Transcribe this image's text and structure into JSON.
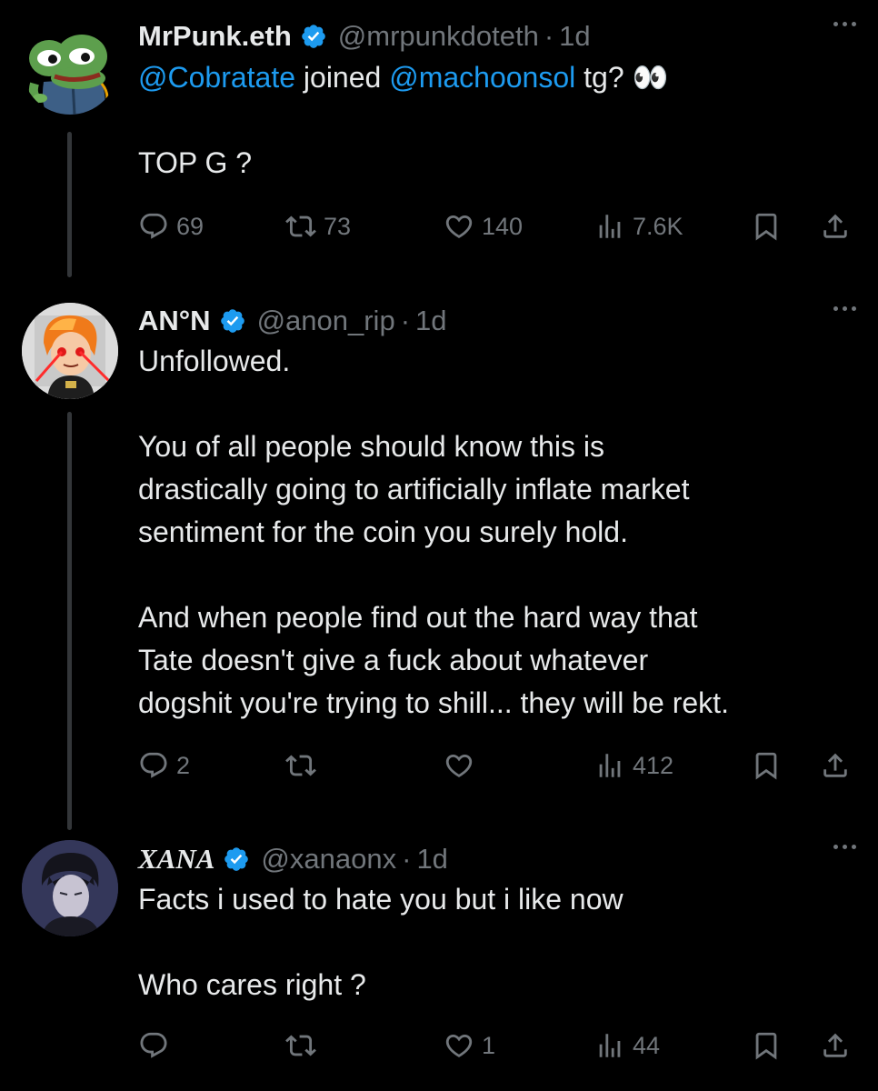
{
  "tweets": [
    {
      "name": "MrPunk.eth",
      "handle": "@mrpunkdoteth",
      "sep": "·",
      "time": "1d",
      "line1": {
        "mention1": "@Cobratate",
        "mid": " joined ",
        "mention2": "@machoonsol",
        "end": " tg? 👀"
      },
      "line2": "TOP G ?",
      "replies": "69",
      "reposts": "73",
      "likes": "140",
      "views": "7.6K"
    },
    {
      "name": "AN°N",
      "handle": "@anon_rip",
      "sep": "·",
      "time": "1d",
      "lines": [
        "Unfollowed.",
        "",
        "You of all people should know this is",
        "drastically going to artificially inflate market",
        "sentiment for the coin you surely hold.",
        "",
        "And when people find out the hard way that",
        "Tate doesn't give a fuck about whatever",
        "dogshit you're trying to shill... they will be rekt."
      ],
      "replies": "2",
      "reposts": "",
      "likes": "",
      "views": "412"
    },
    {
      "name": "XANA",
      "handle": "@xanaonx",
      "sep": "·",
      "time": "1d",
      "lines": [
        "Facts i used to hate you but i like now",
        "",
        "Who cares right ?"
      ],
      "replies": "",
      "reposts": "",
      "likes": "1",
      "views": "44"
    }
  ],
  "colors": {
    "background": "#000000",
    "text": "#e7e9ea",
    "muted": "#71767b",
    "link": "#1d9bf0",
    "verified": "#1d9bf0"
  },
  "icons": [
    "reply-icon",
    "repost-icon",
    "like-icon",
    "views-icon",
    "bookmark-icon",
    "share-icon",
    "more-icon",
    "verified-badge-icon"
  ]
}
